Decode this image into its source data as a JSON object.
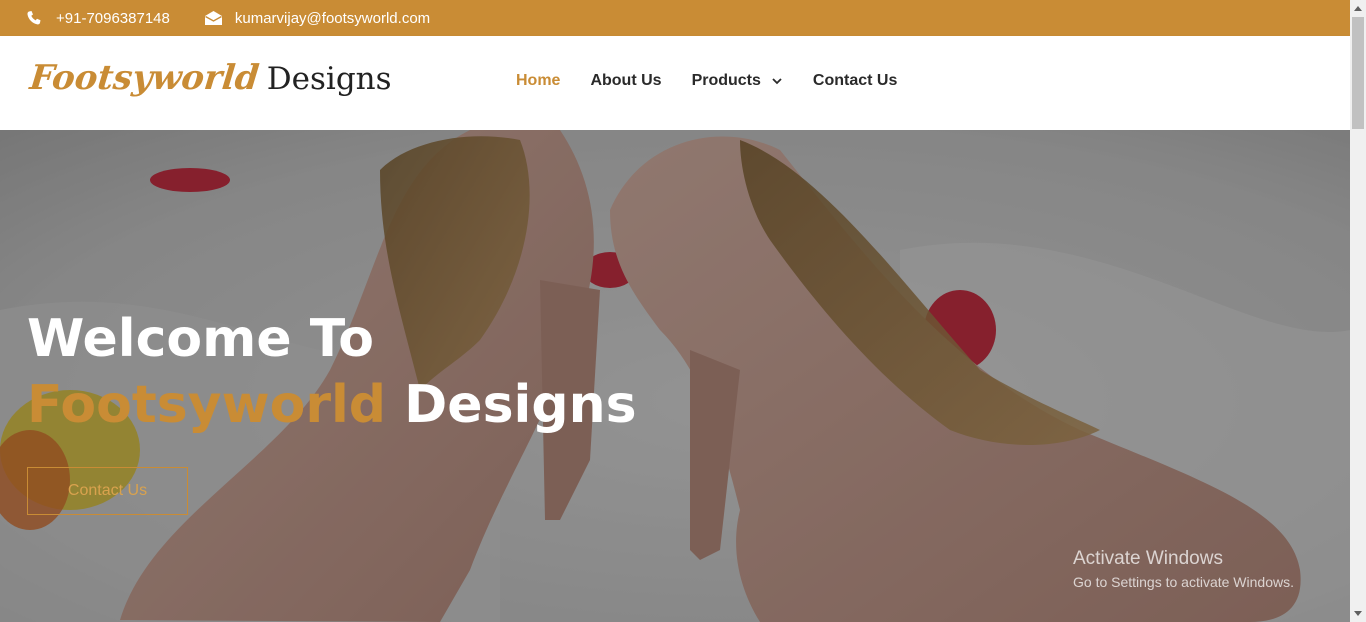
{
  "topbar": {
    "phone": "+91-7096387148",
    "email": "kumarvijay@footsyworld.com",
    "phone_icon": "phone-icon",
    "email_icon": "envelope-icon"
  },
  "logo": {
    "part1": "Footsyworld",
    "part2": "Designs"
  },
  "nav": {
    "items": [
      {
        "label": "Home",
        "active": true
      },
      {
        "label": "About Us"
      },
      {
        "label": "Products",
        "has_dropdown": true
      },
      {
        "label": "Contact Us"
      }
    ]
  },
  "hero": {
    "line1": "Welcome To",
    "line2_highlight": "Footsyworld",
    "line2_rest": "Designs",
    "button_label": "Contact Us"
  },
  "watermark": {
    "title": "Activate Windows",
    "subtitle": "Go to Settings to activate Windows."
  },
  "colors": {
    "accent": "#c98c35",
    "text_dark": "#2a2a2a",
    "white": "#ffffff"
  }
}
